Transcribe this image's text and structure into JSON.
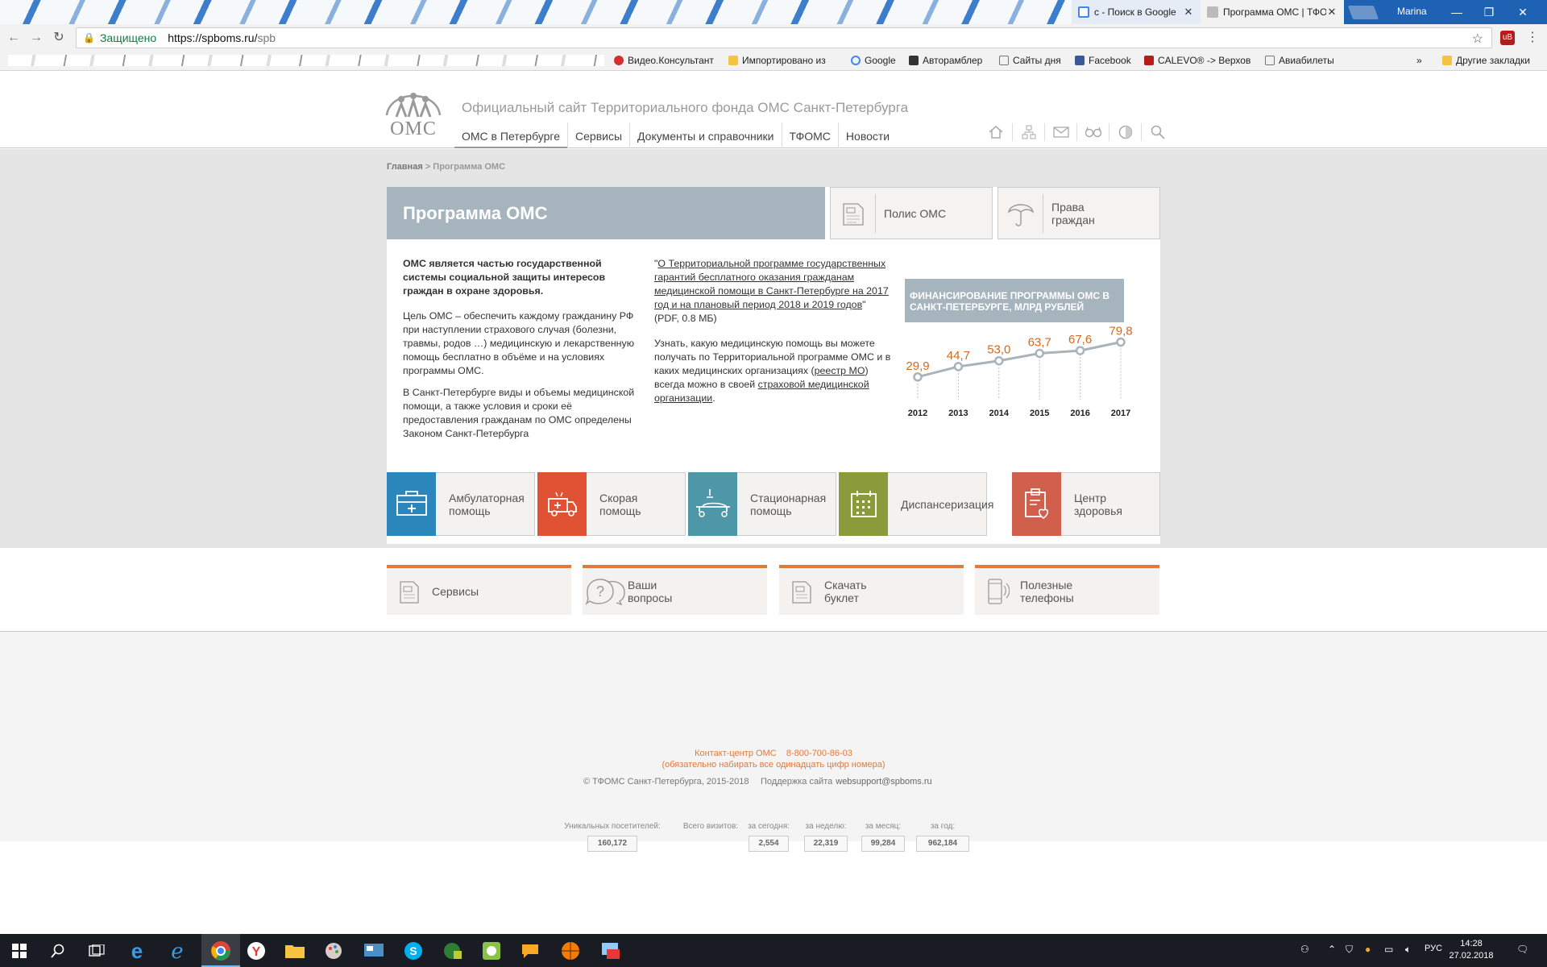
{
  "browser": {
    "tabs": [
      {
        "label": "с - Поиск в Google",
        "close": "✕"
      },
      {
        "label": "Программа ОМС | ТФО",
        "close": "✕"
      }
    ],
    "user": "Marina",
    "security_label": "Защищено",
    "url_host": "https://spboms.ru/",
    "url_path": "spb",
    "bookmarks": [
      "Видео.Консультант",
      "Импортировано из",
      "Google",
      "Авторамблер",
      "Сайты дня",
      "Facebook",
      "CALEVO® -> Верхов",
      "Авиабилеты"
    ],
    "more_bookmarks": "»",
    "other_bookmarks": "Другие закладки"
  },
  "site": {
    "logo_text": "ОМС",
    "title": "Официальный сайт Территориального фонда ОМС Санкт-Петербурга",
    "nav": [
      "ОМС в Петербурге",
      "Сервисы",
      "Документы и справочники",
      "ТФОМС",
      "Новости"
    ]
  },
  "breadcrumb": {
    "home": "Главная",
    "sep": " > ",
    "current": "Программа ОМС"
  },
  "heading": "Программа ОМС",
  "quick": {
    "policy": "Полис ОМС",
    "rights_1": "Права",
    "rights_2": "граждан"
  },
  "col1": {
    "lead": "ОМС является частью государственной системы социальной защиты интересов граждан в охране здоровья.",
    "p1": "Цель ОМС – обеспечить каждому гражданину РФ при наступлении страхового случая (болезни, травмы, родов …) медицинскую и лекарственную помощь бесплатно в объёме и на условиях программы ОМС.",
    "p2": "В Санкт-Петербурге виды и объемы медицинской помощи, а также условия и сроки её предоставления гражданам по ОМС определены Законом Санкт-Петербурга"
  },
  "col2": {
    "quote": "\"",
    "link1": "О Территориальной программе государственных гарантий бесплатного оказания гражданам медицинской помощи в Санкт-Петербурге на 2017 год и на плановый период 2018 и 2019 годов",
    "after1": "\" (PDF, 0.8 МБ)",
    "p2_start": "Узнать, какую медицинскую помощь вы можете получать по Территориальной программе ОМС и в каких медицинских организациях (",
    "link2": "реестр МО",
    "p2_mid": ") всегда можно в своей ",
    "link3": "страховой медицинской организации",
    "p2_end": "."
  },
  "finance_title": "ФИНАНСИРОВАНИЕ ПРОГРАММЫ ОМС В САНКТ-ПЕТЕРБУРГЕ, МЛРД РУБЛЕЙ",
  "chart_data": {
    "type": "line",
    "title": "ФИНАНСИРОВАНИЕ ПРОГРАММЫ ОМС В САНКТ-ПЕТЕРБУРГЕ, МЛРД РУБЛЕЙ",
    "categories": [
      "2012",
      "2013",
      "2014",
      "2015",
      "2016",
      "2017"
    ],
    "value_labels": [
      "29,9",
      "44,7",
      "53,0",
      "63,7",
      "67,6",
      "79,8"
    ],
    "values": [
      29.9,
      44.7,
      53.0,
      63.7,
      67.6,
      79.8
    ],
    "ylim": [
      25,
      85
    ],
    "grid": false,
    "line_color": "#a9b3ba",
    "label_color": "#d2691e"
  },
  "tiles": [
    {
      "l1": "Амбулаторная",
      "l2": "помощь",
      "color": "#2a86bb"
    },
    {
      "l1": "Скорая",
      "l2": "помощь",
      "color": "#e05233"
    },
    {
      "l1": "Стационарная",
      "l2": "помощь",
      "color": "#4e97a8"
    },
    {
      "l1": "Диспансеризация",
      "l2": "",
      "color": "#8b9a3b"
    },
    {
      "l1": "Центр",
      "l2": "здоровья",
      "color": "#d0604b"
    }
  ],
  "services": [
    {
      "l1": "Сервисы",
      "l2": ""
    },
    {
      "l1": "Ваши",
      "l2": "вопросы"
    },
    {
      "l1": "Скачать",
      "l2": "буклет"
    },
    {
      "l1": "Полезные",
      "l2": "телефоны"
    }
  ],
  "footer": {
    "contact_label": "Контакт-центр ОМС",
    "contact_phone": "8-800-700-86-03",
    "contact_note": "(обязательно набирать все одинадцать цифр номера)",
    "copyright": "© ТФОМС Санкт-Петербурга, 2015-2018",
    "support_label": "Поддержка сайта",
    "support_email": "websupport@spboms.ru",
    "stats": [
      {
        "label": "Уникальных посетителей:",
        "value": "160,172"
      },
      {
        "label": "Всего визитов:",
        "value": ""
      },
      {
        "label": "за сегодня:",
        "value": "2,554"
      },
      {
        "label": "за неделю:",
        "value": "22,319"
      },
      {
        "label": "за месяц:",
        "value": "99,284"
      },
      {
        "label": "за год:",
        "value": "962,184"
      }
    ]
  },
  "taskbar": {
    "time": "14:28",
    "date": "27.02.2018",
    "lang": "РУС"
  }
}
